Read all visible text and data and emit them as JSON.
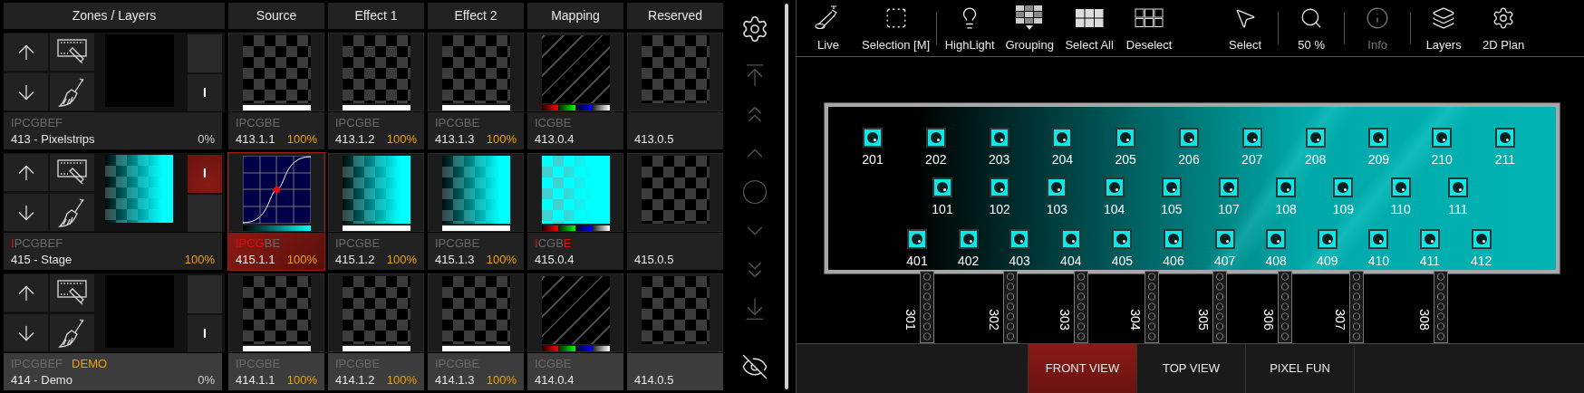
{
  "zones_panel": {
    "columns": [
      "Zones / Layers",
      "Source",
      "Effect 1",
      "Effect 2",
      "Mapping",
      "Reserved"
    ],
    "rows": [
      {
        "selected": false,
        "cells": [
          {
            "kind": "zone",
            "preview": {
              "kind": "black"
            },
            "solo_label": "I",
            "solo_on": false,
            "code": [
              {
                "text": "IPCGBEF",
                "active": false
              }
            ],
            "name": "413 - Pixelstrips",
            "percent": "0%",
            "percent_full": false
          },
          {
            "kind": "layer",
            "preview": {
              "kind": "checker"
            },
            "bar": {
              "kind": "white"
            },
            "code": [
              {
                "text": "IPCGBE",
                "active": false
              }
            ],
            "id": "413.1.1",
            "percent": "100%",
            "selected": false
          },
          {
            "kind": "layer",
            "preview": {
              "kind": "checker"
            },
            "bar": {
              "kind": "white"
            },
            "code": [
              {
                "text": "IPCGBE",
                "active": false
              }
            ],
            "id": "413.1.2",
            "percent": "100%",
            "selected": false
          },
          {
            "kind": "layer",
            "preview": {
              "kind": "checker"
            },
            "bar": {
              "kind": "white"
            },
            "code": [
              {
                "text": "IPCGBE",
                "active": false
              }
            ],
            "id": "413.1.3",
            "percent": "100%",
            "selected": false
          },
          {
            "kind": "layer",
            "preview": {
              "kind": "stripes"
            },
            "bar": {
              "kind": "rgbw"
            },
            "code": [
              {
                "text": "ICGBE",
                "active": false
              }
            ],
            "id": "413.0.4",
            "selected": false
          },
          {
            "kind": "layer",
            "preview": {
              "kind": "checker"
            },
            "id": "413.0.5",
            "selected": false
          }
        ]
      },
      {
        "selected": false,
        "cells": [
          {
            "kind": "zone",
            "preview": {
              "kind": "fade"
            },
            "solo_label": "I",
            "solo_on": true,
            "code": [
              {
                "text": "I",
                "active": true
              },
              {
                "text": "PCGBEF",
                "active": false
              }
            ],
            "name": "415 - Stage",
            "percent": "100%",
            "percent_full": true
          },
          {
            "kind": "layer",
            "preview": {
              "kind": "curve"
            },
            "bar": {
              "kind": "gradient"
            },
            "code": [
              {
                "text": "IPCG",
                "active": true
              },
              {
                "text": "BE",
                "active": false
              }
            ],
            "id": "415.1.1",
            "percent": "100%",
            "selected": true
          },
          {
            "kind": "layer",
            "preview": {
              "kind": "fade"
            },
            "bar": {
              "kind": "white"
            },
            "code": [
              {
                "text": "IPCGBE",
                "active": false
              }
            ],
            "id": "415.1.2",
            "percent": "100%",
            "selected": false
          },
          {
            "kind": "layer",
            "preview": {
              "kind": "fade"
            },
            "bar": {
              "kind": "white"
            },
            "code": [
              {
                "text": "IPCGBE",
                "active": false
              }
            ],
            "id": "415.1.3",
            "percent": "100%",
            "selected": false
          },
          {
            "kind": "layer",
            "preview": {
              "kind": "fill"
            },
            "bar": {
              "kind": "rgbw"
            },
            "code": [
              {
                "text": "I",
                "active": true
              },
              {
                "text": "CGB",
                "active": false
              },
              {
                "text": "E",
                "active": true
              }
            ],
            "id": "415.0.4",
            "selected": false
          },
          {
            "kind": "layer",
            "preview": {
              "kind": "checker"
            },
            "id": "415.0.5",
            "selected": false
          }
        ]
      },
      {
        "selected": true,
        "cells": [
          {
            "kind": "zone",
            "preview": {
              "kind": "black"
            },
            "solo_label": "I",
            "solo_on": false,
            "code": [
              {
                "text": "IPCGBEF",
                "active": false
              }
            ],
            "tag": "DEMO",
            "name": "414 - Demo",
            "percent": "0%",
            "percent_full": false
          },
          {
            "kind": "layer",
            "preview": {
              "kind": "checker"
            },
            "bar": {
              "kind": "white"
            },
            "code": [
              {
                "text": "IPCGBE",
                "active": false
              }
            ],
            "id": "414.1.1",
            "percent": "100%",
            "selected": false
          },
          {
            "kind": "layer",
            "preview": {
              "kind": "checker"
            },
            "bar": {
              "kind": "white"
            },
            "code": [
              {
                "text": "IPCGBE",
                "active": false
              }
            ],
            "id": "414.1.2",
            "percent": "100%",
            "selected": false
          },
          {
            "kind": "layer",
            "preview": {
              "kind": "checker"
            },
            "bar": {
              "kind": "white"
            },
            "code": [
              {
                "text": "IPCGBE",
                "active": false
              }
            ],
            "id": "414.1.3",
            "percent": "100%",
            "selected": false
          },
          {
            "kind": "layer",
            "preview": {
              "kind": "stripes"
            },
            "bar": {
              "kind": "rgbw"
            },
            "code": [
              {
                "text": "ICGBE",
                "active": false
              }
            ],
            "id": "414.0.4",
            "selected": false
          },
          {
            "kind": "layer",
            "preview": {
              "kind": "checker"
            },
            "id": "414.0.5",
            "selected": false
          }
        ]
      }
    ]
  },
  "toolbar": {
    "groups": [
      {
        "divider_before": false,
        "items": [
          {
            "kind": "spotlight",
            "label": "Live",
            "disabled": false
          },
          {
            "kind": "dashed_square",
            "label": "Selection [M]",
            "disabled": false
          }
        ]
      },
      {
        "divider_before": true,
        "items": [
          {
            "kind": "bulb",
            "label": "HighLight",
            "disabled": false
          },
          {
            "kind": "grouping",
            "label": "Grouping",
            "disabled": false
          },
          {
            "kind": "grid_filled",
            "label": "Select All",
            "disabled": false
          },
          {
            "kind": "grid_outline",
            "label": "Deselect",
            "disabled": false
          }
        ]
      },
      {
        "divider_before": false,
        "items": [
          {
            "kind": "pointer",
            "label": "Select",
            "disabled": false
          }
        ]
      },
      {
        "divider_before": true,
        "items": [
          {
            "kind": "zoom",
            "label": "50 %",
            "disabled": false
          }
        ]
      },
      {
        "divider_before": true,
        "items": [
          {
            "kind": "info",
            "label": "Info",
            "disabled": true
          }
        ]
      },
      {
        "divider_before": true,
        "items": [
          {
            "kind": "layers",
            "label": "Layers",
            "disabled": false
          },
          {
            "kind": "gear",
            "label": "2D Plan",
            "disabled": false
          }
        ]
      }
    ]
  },
  "stage": {
    "fixture_rows": [
      [
        "201",
        "202",
        "203",
        "204",
        "205",
        "206",
        "207",
        "208",
        "209",
        "210",
        "211"
      ],
      [
        "101",
        "102",
        "103",
        "104",
        "105",
        "107",
        "108",
        "109",
        "110",
        "111"
      ],
      [
        "401",
        "402",
        "403",
        "404",
        "405",
        "406",
        "407",
        "408",
        "409",
        "410",
        "411",
        "412"
      ]
    ],
    "trusses": [
      "301",
      "302",
      "303",
      "304",
      "305",
      "306",
      "307",
      "308"
    ]
  },
  "view_tabs": [
    {
      "label": "FRONT VIEW",
      "selected": true
    },
    {
      "label": "TOP VIEW",
      "selected": false
    },
    {
      "label": "PIXEL FUN",
      "selected": false
    }
  ]
}
